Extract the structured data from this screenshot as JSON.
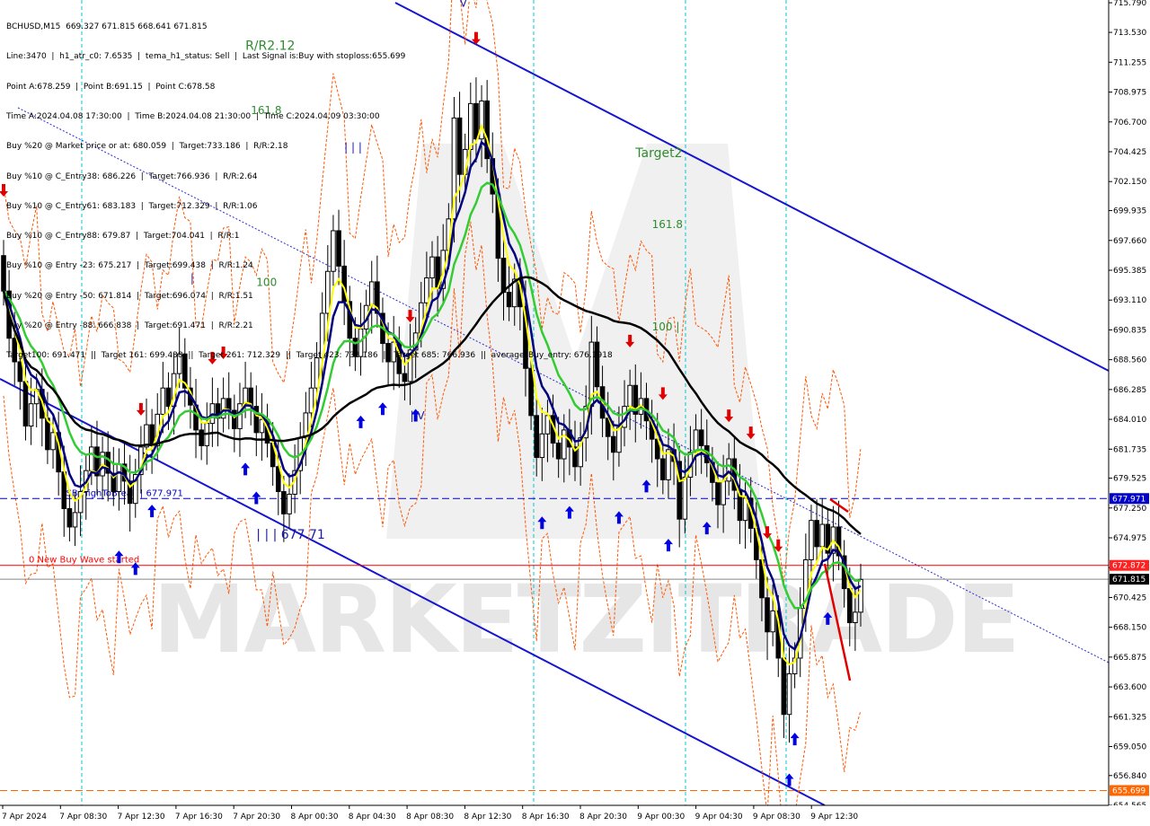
{
  "header": {
    "lines": [
      "BCHUSD,M15  669.327 671.815 668.641 671.815",
      "Line:3470  |  h1_atr_c0: 7.6535  |  tema_h1_status: Sell  |  Last Signal is:Buy with stoploss:655.699",
      "Point A:678.259  |  Point B:691.15  |  Point C:678.58",
      "Time A:2024.04.08 17:30:00  |  Time B:2024.04.08 21:30:00  |  Time C:2024.04.09 03:30:00",
      "Buy %20 @ Market price or at: 680.059  |  Target:733.186  |  R/R:2.18",
      "Buy %10 @ C_Entry38: 686.226  |  Target:766.936  |  R/R:2.64",
      "Buy %10 @ C_Entry61: 683.183  |  Target:712.329  |  R/R:1.06",
      "Buy %10 @ C_Entry88: 679.87  |  Target:704.041  |  R/R:1",
      "Buy %10 @ Entry -23: 675.217  |  Target:699.438  |  R/R:1.24",
      "Buy %20 @ Entry -50: 671.814  |  Target:696.074  |  R/R:1.51",
      "Buy %20 @ Entry -88: 666.838  |  Target:691.471  |  R/R:2.21",
      "Target100: 691.471  ||  Target 161: 699.438  ||  Target 261: 712.329  ||  Target 423: 733.186  ||  Target 685: 766.936  ||  average_Buy_entry: 676.1918"
    ]
  },
  "chart_data": {
    "type": "candlestick",
    "symbol": "BCHUSD,M15",
    "ylim": [
      654.565,
      716.0
    ],
    "y_ticks": [
      "715.790",
      "713.530",
      "711.255",
      "708.975",
      "706.700",
      "704.425",
      "702.150",
      "699.935",
      "697.660",
      "695.385",
      "693.110",
      "690.835",
      "688.560",
      "686.285",
      "684.010",
      "681.735",
      "679.525",
      "677.250",
      "674.975",
      "672.700",
      "670.425",
      "668.150",
      "665.875",
      "663.600",
      "661.325",
      "659.050",
      "656.840",
      "654.565"
    ],
    "x_ticks": [
      "7 Apr 2024",
      "7 Apr 08:30",
      "7 Apr 12:30",
      "7 Apr 16:30",
      "7 Apr 20:30",
      "8 Apr 00:30",
      "8 Apr 04:30",
      "8 Apr 08:30",
      "8 Apr 12:30",
      "8 Apr 16:30",
      "8 Apr 20:30",
      "9 Apr 00:30",
      "9 Apr 04:30",
      "9 Apr 08:30",
      "9 Apr 12:30"
    ],
    "price_tags": [
      {
        "value": 677.971,
        "label": "677.971",
        "color": "#0000cc"
      },
      {
        "value": 672.872,
        "label": "672.872",
        "color": "#ff2020"
      },
      {
        "value": 671.815,
        "label": "671.815",
        "color": "#000000"
      },
      {
        "value": 655.699,
        "label": "655.699",
        "color": "#ff6600"
      }
    ],
    "hlines": [
      {
        "value": 677.971,
        "label": "FSB-HighToBreak | 677.971",
        "color": "#0000cc",
        "style": "dashed"
      },
      {
        "value": 672.872,
        "label": "0 New Buy Wave started",
        "color": "#ff0000",
        "style": "solid"
      },
      {
        "value": 671.815,
        "label": "",
        "color": "#888888",
        "style": "solid"
      },
      {
        "value": 655.699,
        "label": "",
        "color": "#ff6600",
        "style": "dashed"
      }
    ],
    "annotations": [
      {
        "text": "Target2",
        "price": 704.0,
        "x_index": 115,
        "color": "#2e8b2e"
      },
      {
        "text": "161.8",
        "price": 698.6,
        "x_index": 118,
        "color": "#2e8b2e"
      },
      {
        "text": "161.8",
        "price": 707.3,
        "x_index": 45,
        "color": "#2e8b2e"
      },
      {
        "text": "100",
        "price": 694.2,
        "x_index": 46,
        "color": "#2e8b2e"
      },
      {
        "text": "100 |",
        "price": 690.8,
        "x_index": 118,
        "color": "#2e8b2e"
      },
      {
        "text": "R/R2.12",
        "price": 712.2,
        "x_index": 44,
        "color": "#2e8b2e"
      },
      {
        "text": "| V",
        "price": 684.0,
        "x_index": 74,
        "color": "#1a1aa8"
      },
      {
        "text": "| | |",
        "price": 704.5,
        "x_index": 62,
        "color": "#1a1aa8"
      },
      {
        "text": "|",
        "price": 694.5,
        "x_index": 34,
        "color": "#1a1aa8"
      },
      {
        "text": "V",
        "price": 715.5,
        "x_index": 83,
        "color": "#1a1aa8"
      },
      {
        "text": "| | | 677.71",
        "price": 674.9,
        "x_index": 46,
        "color": "#1a1aa8"
      }
    ],
    "watermark": "MARKETZITRADE",
    "series": [
      {
        "name": "MA fast",
        "color": "#ffff00"
      },
      {
        "name": "MA mid",
        "color": "#000080"
      },
      {
        "name": "MA slow",
        "color": "#33cc33"
      },
      {
        "name": "MA long",
        "color": "#000000"
      }
    ],
    "candles": [
      [
        696.5,
        693.8
      ],
      [
        693.8,
        690.2
      ],
      [
        690.2,
        688.4
      ],
      [
        688.4,
        686.9
      ],
      [
        686.9,
        683.5
      ],
      [
        683.5,
        685.2
      ],
      [
        685.2,
        686.3
      ],
      [
        686.3,
        684.1
      ],
      [
        684.1,
        681.7
      ],
      [
        681.7,
        683.0
      ],
      [
        683.0,
        680.0
      ],
      [
        680.0,
        677.2
      ],
      [
        677.2,
        675.8
      ],
      [
        675.8,
        676.9
      ],
      [
        676.9,
        678.5
      ],
      [
        678.5,
        680.1
      ],
      [
        680.1,
        681.9
      ],
      [
        681.9,
        679.7
      ],
      [
        679.7,
        681.5
      ],
      [
        681.5,
        679.9
      ],
      [
        679.9,
        678.5
      ],
      [
        678.5,
        680.6
      ],
      [
        680.6,
        679.3
      ],
      [
        679.3,
        677.6
      ],
      [
        677.6,
        679.8
      ],
      [
        679.8,
        681.9
      ],
      [
        681.9,
        683.6
      ],
      [
        683.6,
        682.0
      ],
      [
        682.0,
        684.4
      ],
      [
        684.4,
        686.4
      ],
      [
        686.4,
        685.0
      ],
      [
        685.0,
        687.5
      ],
      [
        687.5,
        689.0
      ],
      [
        689.0,
        686.4
      ],
      [
        686.4,
        685.1
      ],
      [
        685.1,
        683.2
      ],
      [
        683.2,
        682.0
      ],
      [
        682.0,
        683.7
      ],
      [
        683.7,
        685.2
      ],
      [
        685.2,
        684.1
      ],
      [
        684.1,
        685.6
      ],
      [
        685.6,
        684.7
      ],
      [
        684.7,
        683.3
      ],
      [
        683.3,
        685.2
      ],
      [
        685.2,
        686.4
      ],
      [
        686.4,
        685.0
      ],
      [
        685.0,
        683.0
      ],
      [
        683.0,
        684.0
      ],
      [
        684.0,
        682.2
      ],
      [
        682.2,
        680.4
      ],
      [
        680.4,
        678.5
      ],
      [
        678.5,
        676.8
      ],
      [
        676.8,
        678.3
      ],
      [
        678.3,
        680.1
      ],
      [
        680.1,
        682.6
      ],
      [
        682.6,
        684.5
      ],
      [
        684.5,
        686.4
      ],
      [
        686.4,
        688.7
      ],
      [
        688.7,
        692.1
      ],
      [
        692.1,
        695.3
      ],
      [
        695.3,
        698.4
      ],
      [
        698.4,
        695.7
      ],
      [
        695.7,
        693.0
      ],
      [
        693.0,
        690.2
      ],
      [
        690.2,
        688.8
      ],
      [
        688.8,
        690.9
      ],
      [
        690.9,
        692.7
      ],
      [
        692.7,
        694.5
      ],
      [
        694.5,
        692.1
      ],
      [
        692.1,
        689.8
      ],
      [
        689.8,
        688.4
      ],
      [
        688.4,
        689.9
      ],
      [
        689.9,
        687.5
      ],
      [
        687.5,
        686.9
      ],
      [
        686.9,
        689.3
      ],
      [
        689.3,
        690.6
      ],
      [
        690.6,
        692.9
      ],
      [
        692.9,
        694.8
      ],
      [
        694.8,
        696.4
      ],
      [
        696.4,
        694.0
      ],
      [
        694.0,
        696.9
      ],
      [
        696.9,
        699.3
      ],
      [
        699.3,
        707.0
      ],
      [
        707.0,
        702.7
      ],
      [
        702.7,
        704.6
      ],
      [
        704.6,
        708.1
      ],
      [
        708.1,
        705.4
      ],
      [
        705.4,
        708.3
      ],
      [
        708.3,
        703.9
      ],
      [
        703.9,
        701.2
      ],
      [
        701.2,
        696.3
      ],
      [
        696.3,
        693.7
      ],
      [
        693.7,
        692.6
      ],
      [
        692.6,
        694.7
      ],
      [
        694.7,
        692.6
      ],
      [
        692.6,
        687.9
      ],
      [
        687.9,
        684.3
      ],
      [
        684.3,
        681.1
      ],
      [
        681.1,
        682.9
      ],
      [
        682.9,
        684.3
      ],
      [
        684.3,
        682.2
      ],
      [
        682.2,
        681.0
      ],
      [
        681.0,
        683.2
      ],
      [
        683.2,
        681.9
      ],
      [
        681.9,
        680.4
      ],
      [
        680.4,
        682.6
      ],
      [
        682.6,
        685.0
      ],
      [
        685.0,
        689.9
      ],
      [
        689.9,
        686.5
      ],
      [
        686.5,
        684.1
      ],
      [
        684.1,
        682.7
      ],
      [
        682.7,
        681.5
      ],
      [
        681.5,
        683.4
      ],
      [
        683.4,
        685.0
      ],
      [
        685.0,
        686.6
      ],
      [
        686.6,
        684.4
      ],
      [
        684.4,
        685.6
      ],
      [
        685.6,
        683.9
      ],
      [
        683.9,
        682.5
      ],
      [
        682.5,
        681.0
      ],
      [
        681.0,
        679.4
      ],
      [
        679.4,
        681.7
      ],
      [
        681.7,
        680.8
      ],
      [
        680.8,
        676.4
      ],
      [
        676.4,
        679.6
      ],
      [
        679.6,
        681.5
      ],
      [
        681.5,
        683.2
      ],
      [
        683.2,
        682.0
      ],
      [
        682.0,
        680.7
      ],
      [
        680.7,
        679.2
      ],
      [
        679.2,
        677.5
      ],
      [
        677.5,
        679.3
      ],
      [
        679.3,
        681.0
      ],
      [
        681.0,
        678.6
      ],
      [
        678.6,
        676.3
      ],
      [
        676.3,
        678.0
      ],
      [
        678.0,
        675.7
      ],
      [
        675.7,
        673.3
      ],
      [
        673.3,
        670.4
      ],
      [
        670.4,
        667.8
      ],
      [
        667.8,
        669.4
      ],
      [
        669.4,
        665.8
      ],
      [
        665.8,
        661.5
      ],
      [
        661.5,
        664.6
      ],
      [
        664.6,
        665.8
      ],
      [
        665.8,
        669.6
      ],
      [
        669.6,
        673.3
      ],
      [
        673.3,
        676.3
      ],
      [
        676.3,
        674.3
      ],
      [
        674.3,
        676.0
      ],
      [
        676.0,
        673.8
      ],
      [
        673.8,
        675.8
      ],
      [
        675.8,
        673.6
      ],
      [
        673.6,
        671.1
      ],
      [
        671.1,
        668.5
      ],
      [
        668.5,
        669.3
      ],
      [
        669.3,
        671.8
      ]
    ]
  }
}
